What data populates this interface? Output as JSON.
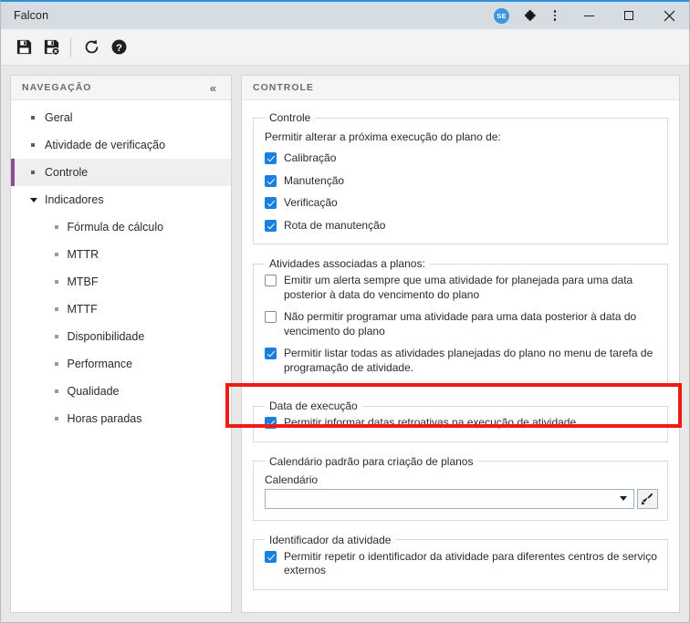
{
  "window": {
    "title": "Falcon",
    "avatar_initials": "SE",
    "accent_color": "#2f8fd8",
    "checkbox_color": "#1b7fe0",
    "active_marker_color": "#8a4da0",
    "annotation_color": "#ef1b14",
    "controls": {
      "extension_icon": "puzzle-piece-icon",
      "menu_icon": "kebab-menu-icon",
      "minimize": "minimize-icon",
      "maximize": "maximize-icon",
      "close": "close-icon"
    }
  },
  "toolbar": {
    "items": [
      {
        "name": "save-icon",
        "title": "Salvar"
      },
      {
        "name": "save-and-close-icon",
        "title": "Salvar e fechar"
      },
      {
        "name": "refresh-icon",
        "title": "Atualizar"
      },
      {
        "name": "help-icon",
        "title": "Ajuda"
      }
    ]
  },
  "sidebar": {
    "header": "NAVEGAÇÃO",
    "collapse_icon": "«",
    "items": [
      {
        "label": "Geral",
        "level": 0,
        "active": false,
        "expandable": false
      },
      {
        "label": "Atividade de verificação",
        "level": 0,
        "active": false,
        "expandable": false
      },
      {
        "label": "Controle",
        "level": 0,
        "active": true,
        "expandable": false
      },
      {
        "label": "Indicadores",
        "level": 0,
        "active": false,
        "expandable": true
      },
      {
        "label": "Fórmula de cálculo",
        "level": 1,
        "active": false,
        "expandable": false
      },
      {
        "label": "MTTR",
        "level": 1,
        "active": false,
        "expandable": false
      },
      {
        "label": "MTBF",
        "level": 1,
        "active": false,
        "expandable": false
      },
      {
        "label": "MTTF",
        "level": 1,
        "active": false,
        "expandable": false
      },
      {
        "label": "Disponibilidade",
        "level": 1,
        "active": false,
        "expandable": false
      },
      {
        "label": "Performance",
        "level": 1,
        "active": false,
        "expandable": false
      },
      {
        "label": "Qualidade",
        "level": 1,
        "active": false,
        "expandable": false
      },
      {
        "label": "Horas paradas",
        "level": 1,
        "active": false,
        "expandable": false
      }
    ]
  },
  "content": {
    "header": "CONTROLE",
    "groups": {
      "controle": {
        "legend": "Controle",
        "hint": "Permitir alterar a próxima execução do plano de:",
        "checkboxes": [
          {
            "label": "Calibração",
            "checked": true
          },
          {
            "label": "Manutenção",
            "checked": true
          },
          {
            "label": "Verificação",
            "checked": true
          },
          {
            "label": "Rota de manutenção",
            "checked": true
          }
        ]
      },
      "atividades": {
        "legend": "Atividades associadas a planos:",
        "checkboxes": [
          {
            "label": "Emitir um alerta sempre que uma atividade for planejada para uma data posterior à data do vencimento do plano",
            "checked": false
          },
          {
            "label": "Não permitir programar uma atividade para uma data posterior à data do vencimento do plano",
            "checked": false
          },
          {
            "label": "Permitir listar todas as atividades planejadas do plano no menu de tarefa de programação de atividade.",
            "checked": true
          }
        ]
      },
      "data_execucao": {
        "legend": "Data de execução",
        "checkboxes": [
          {
            "label": "Permitir informar datas retroativas na execução de atividade",
            "checked": true
          }
        ]
      },
      "calendario": {
        "legend": "Calendário padrão para criação de planos",
        "field_label": "Calendário",
        "field_value": "",
        "field_placeholder": "",
        "dropdown_icon": "chevron-down-icon",
        "clear_icon": "brush-clear-icon"
      },
      "identificador": {
        "legend": "Identificador da atividade",
        "checkboxes": [
          {
            "label": "Permitir repetir o identificador da atividade para diferentes centros de serviço externos",
            "checked": true
          }
        ]
      }
    }
  },
  "annotation": {
    "target": "Permitir listar todas as atividades planejadas do plano no menu de tarefa de programação de atividade."
  }
}
